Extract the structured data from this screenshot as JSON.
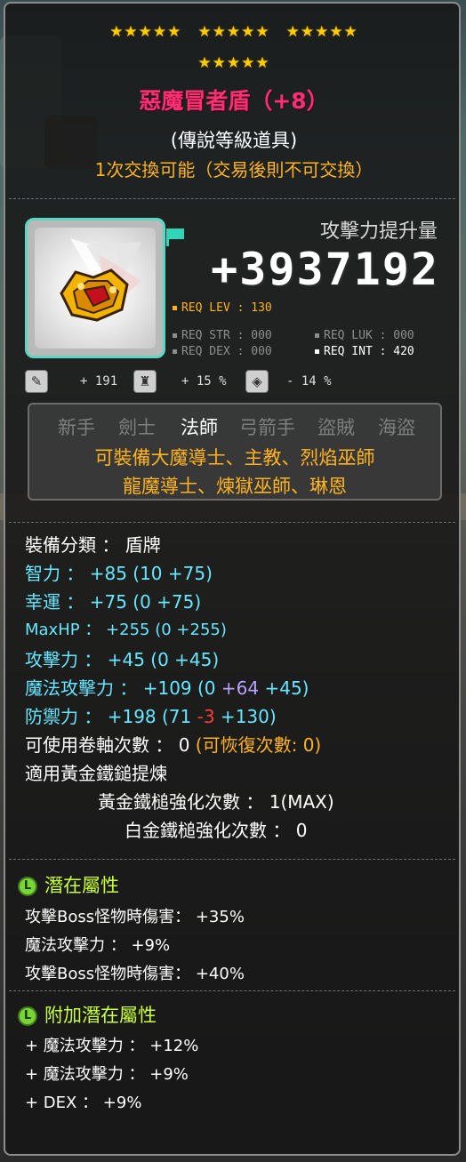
{
  "stars_row1": [
    "★★★★★",
    "★★★★★",
    "★★★★★"
  ],
  "stars_row2": "★★★★★",
  "item": {
    "name": "惡魔冒者盾（+8）",
    "rank": "(傳說等級道具)",
    "trade": "1次交換可能（交易後則不可交換）"
  },
  "attack_boost": {
    "label": "攻擊力提升量",
    "value": "+3937192"
  },
  "requirements": {
    "lev": "REQ LEV : 130",
    "str": "REQ STR : 000",
    "luk": "REQ LUK : 000",
    "dex": "REQ DEX : 000",
    "int": "REQ INT : 420"
  },
  "small_stats": {
    "v1": "+ 191",
    "v2": "+ 15 %",
    "v3": "- 14 %"
  },
  "jobs": [
    "新手",
    "劍士",
    "法師",
    "弓箭手",
    "盜賊",
    "海盜"
  ],
  "job_lines": [
    "可裝備大魔導士、主教、烈焰巫師",
    "龍魔導士、煉獄巫師、琳恩"
  ],
  "stats": {
    "category": "裝備分類 ： 盾牌",
    "int_label": "智力 ：",
    "int_val": " +85 (10 +75)",
    "luk_label": "幸運 ：",
    "luk_val": " +75 (0 +75)",
    "hp_label": "MaxHP ：",
    "hp_val": " +255 (0 +255)",
    "atk_label": "攻擊力 ：",
    "atk_val": " +45 (0 +45)",
    "matk_label": "魔法攻擊力 ：",
    "matk_val1": " +109 (0 ",
    "matk_val2": "+64",
    "matk_val3": " +45)",
    "def_label": "防禦力 ：",
    "def_val1": " +198 (71 ",
    "def_val2": "-3",
    "def_val3": " +130)",
    "scroll_label": "可使用卷軸次數 ： 0 ",
    "scroll_recover": "(可恢復次數: 0)",
    "golden_hammer": "適用黃金鐵鎚提煉",
    "golden_count": "黃金鐵槌強化次數 ： 1(MAX)",
    "platinum_count": "白金鐵槌強化次數 ： 0"
  },
  "potential": {
    "title": "潛在屬性",
    "lines": [
      "攻擊Boss怪物時傷害： +35%",
      "魔法攻擊力 ： +9%",
      "攻擊Boss怪物時傷害： +40%"
    ]
  },
  "additional_potential": {
    "title": "附加潛在屬性",
    "lines": [
      "+ 魔法攻擊力 ： +12%",
      "+ 魔法攻擊力 ： +9%",
      "+ DEX ： +9%"
    ]
  },
  "colors": {
    "name": "#ff2f74",
    "orange": "#ffb321",
    "cyan": "#66e6ff",
    "potential_green": "#c9ff3b"
  }
}
